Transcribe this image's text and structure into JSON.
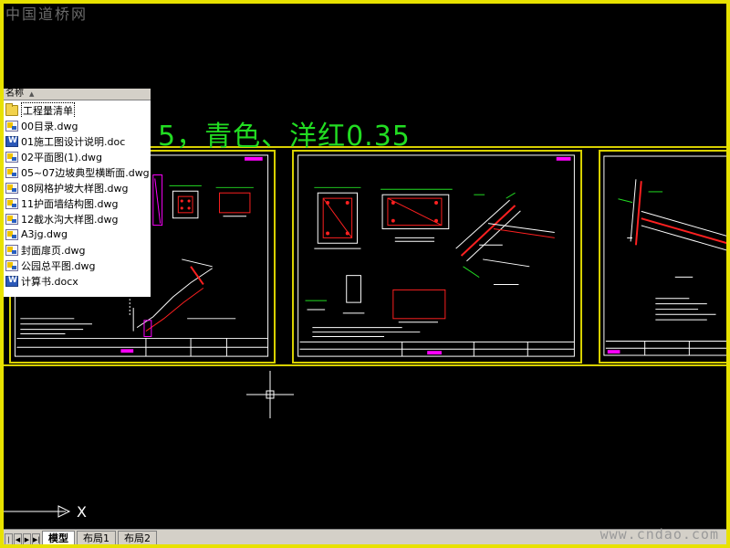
{
  "watermark_top": "中国道桥网",
  "watermark_bottom": "www.cndao.com",
  "drawing_note": "5，青色、洋红0.35",
  "file_panel": {
    "column_header": "名称",
    "items": [
      {
        "name": "工程量清单",
        "icon": "folder-icon",
        "selected": true
      },
      {
        "name": "00目录.dwg",
        "icon": "dwg-file-icon"
      },
      {
        "name": "01施工图设计说明.doc",
        "icon": "word-doc-icon"
      },
      {
        "name": "02平面图(1).dwg",
        "icon": "dwg-file-icon"
      },
      {
        "name": "05~07边坡典型横断面.dwg",
        "icon": "dwg-file-icon"
      },
      {
        "name": "08网格护坡大样图.dwg",
        "icon": "dwg-file-icon"
      },
      {
        "name": "11护面墙结构图.dwg",
        "icon": "dwg-file-icon"
      },
      {
        "name": "12截水沟大样图.dwg",
        "icon": "dwg-file-icon"
      },
      {
        "name": "A3jg.dwg",
        "icon": "dwg-file-icon"
      },
      {
        "name": "封面扉页.dwg",
        "icon": "dwg-file-icon"
      },
      {
        "name": "公园总平图.dwg",
        "icon": "dwg-file-icon"
      },
      {
        "name": "计算书.docx",
        "icon": "word-doc-icon"
      }
    ]
  },
  "ucs": {
    "x_label": "X"
  },
  "layout_tabs": [
    {
      "label": "模型",
      "active": true
    },
    {
      "label": "布局1"
    },
    {
      "label": "布局2"
    }
  ],
  "colors": {
    "frame": "#e8e200",
    "note": "#22dd22",
    "cad_red": "#ff2020",
    "cad_cyan": "#00e0e0",
    "cad_green": "#22dd22",
    "cad_magenta": "#ff00ff",
    "cad_white": "#ffffff"
  }
}
